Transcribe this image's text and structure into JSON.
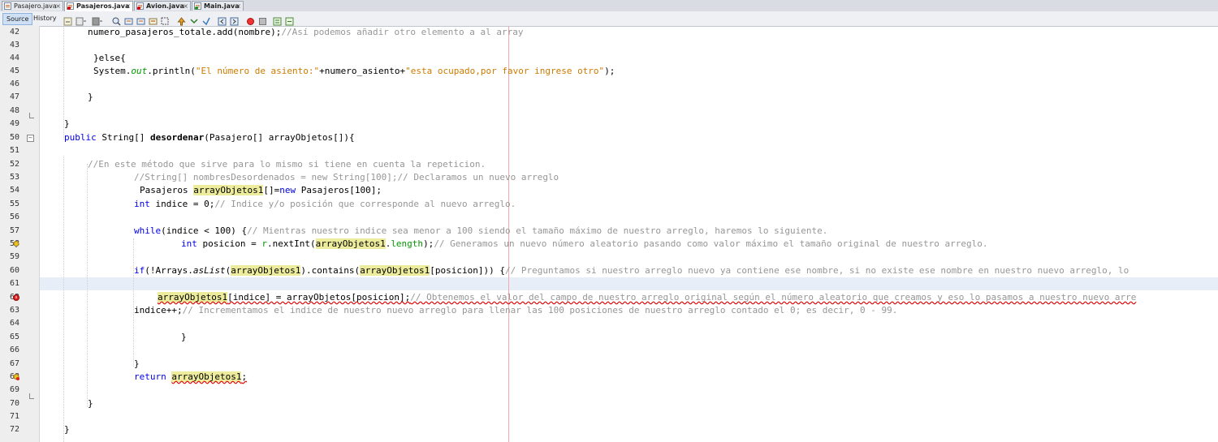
{
  "tabs": [
    {
      "label": "Pasajero.java",
      "close": "×"
    },
    {
      "label": "Pasajeros.java",
      "close": "×"
    },
    {
      "label": "Avion.java",
      "close": "×"
    },
    {
      "label": "Main.java",
      "close": "×"
    }
  ],
  "toolbar": {
    "source_label": "Source",
    "history_label": "History"
  },
  "code": {
    "l42": {
      "a": "numero_pasajeros_totale.add(nombre);",
      "b": "//Así podemos añadir otro elemento a al array"
    },
    "l44": {
      "a": "}else{"
    },
    "l45": {
      "a": "System.",
      "b": "out",
      "c": ".println(",
      "d": "\"El número de asiento:\"",
      "e": "+numero_asiento+",
      "f": "\"esta ocupado,por favor ingrese otro\"",
      "g": ");"
    },
    "l47": {
      "a": "}"
    },
    "l49": {
      "a": "}"
    },
    "l50": {
      "a": "public",
      "b": " String[] ",
      "c": "desordenar",
      "d": "(Pasajero[] arrayObjetos[]){"
    },
    "l52": {
      "a": "//En este método que sirve para lo mismo si tiene en cuenta la repeticion."
    },
    "l53": {
      "a": "//String[] nombresDesordenados = new String[100];// Declaramos un nuevo arreglo"
    },
    "l54": {
      "a": "Pasajeros ",
      "b": "arrayObjetos1",
      "c": "[]=",
      "d": "new",
      "e": " Pasajeros[100];"
    },
    "l55": {
      "a": "int",
      "b": " indice = 0;",
      "c": "// Indice y/o posición que corresponde al nuevo arreglo."
    },
    "l57": {
      "a": "while",
      "b": "(indice < 100) {",
      "c": "// Mientras nuestro indice sea menor a 100 siendo el tamaño máximo de nuestro arreglo, haremos lo siguiente."
    },
    "l58": {
      "a": "int",
      "b": " posicion = ",
      "c": "r",
      "d": ".nextInt(",
      "e": "arrayObjetos1",
      "f": ".",
      "g": "length",
      "h": ");",
      "i": "// Generamos un nuevo número aleatorio pasando como valor máximo el tamaño original de nuestro arreglo."
    },
    "l60": {
      "a": "if",
      "b": "(!Arrays.",
      "c": "asList",
      "d": "(",
      "e": "arrayObjetos1",
      "f": ").contains(",
      "g": "arrayObjetos1",
      "h": "[posicion])) {",
      "i": "// Preguntamos si nuestro arreglo nuevo ya contiene ese nombre, si no existe ese nombre en nuestro nuevo arreglo, lo"
    },
    "l62": {
      "a": "arrayObjetos1",
      "b": "[indice] = arrayObjetos[posicion];",
      "c": "// Obtenemos el valor del campo de nuestro arreglo original según el número aleatorio que creamos y eso lo pasamos a nuestro nuevo arre"
    },
    "l63": {
      "a": "indice++;",
      "b": "// Incrementamos el indice de nuestro nuevo arreglo para llenar las 100 posiciones de nuestro arreglo contado el 0; es decir, 0 - 99."
    },
    "l65": {
      "a": "}"
    },
    "l67": {
      "a": "}"
    },
    "l68": {
      "a": "return",
      "b": " ",
      "c": "arrayObjetos1",
      "d": ";"
    },
    "l70": {
      "a": "}"
    },
    "l72": {
      "a": "}"
    }
  },
  "line_numbers": [
    "42",
    "43",
    "44",
    "45",
    "46",
    "47",
    "48",
    "49",
    "50",
    "51",
    "52",
    "53",
    "54",
    "55",
    "56",
    "57",
    "58",
    "59",
    "60",
    "61",
    "62",
    "63",
    "64",
    "65",
    "66",
    "67",
    "68",
    "69",
    "70",
    "71",
    "72"
  ]
}
